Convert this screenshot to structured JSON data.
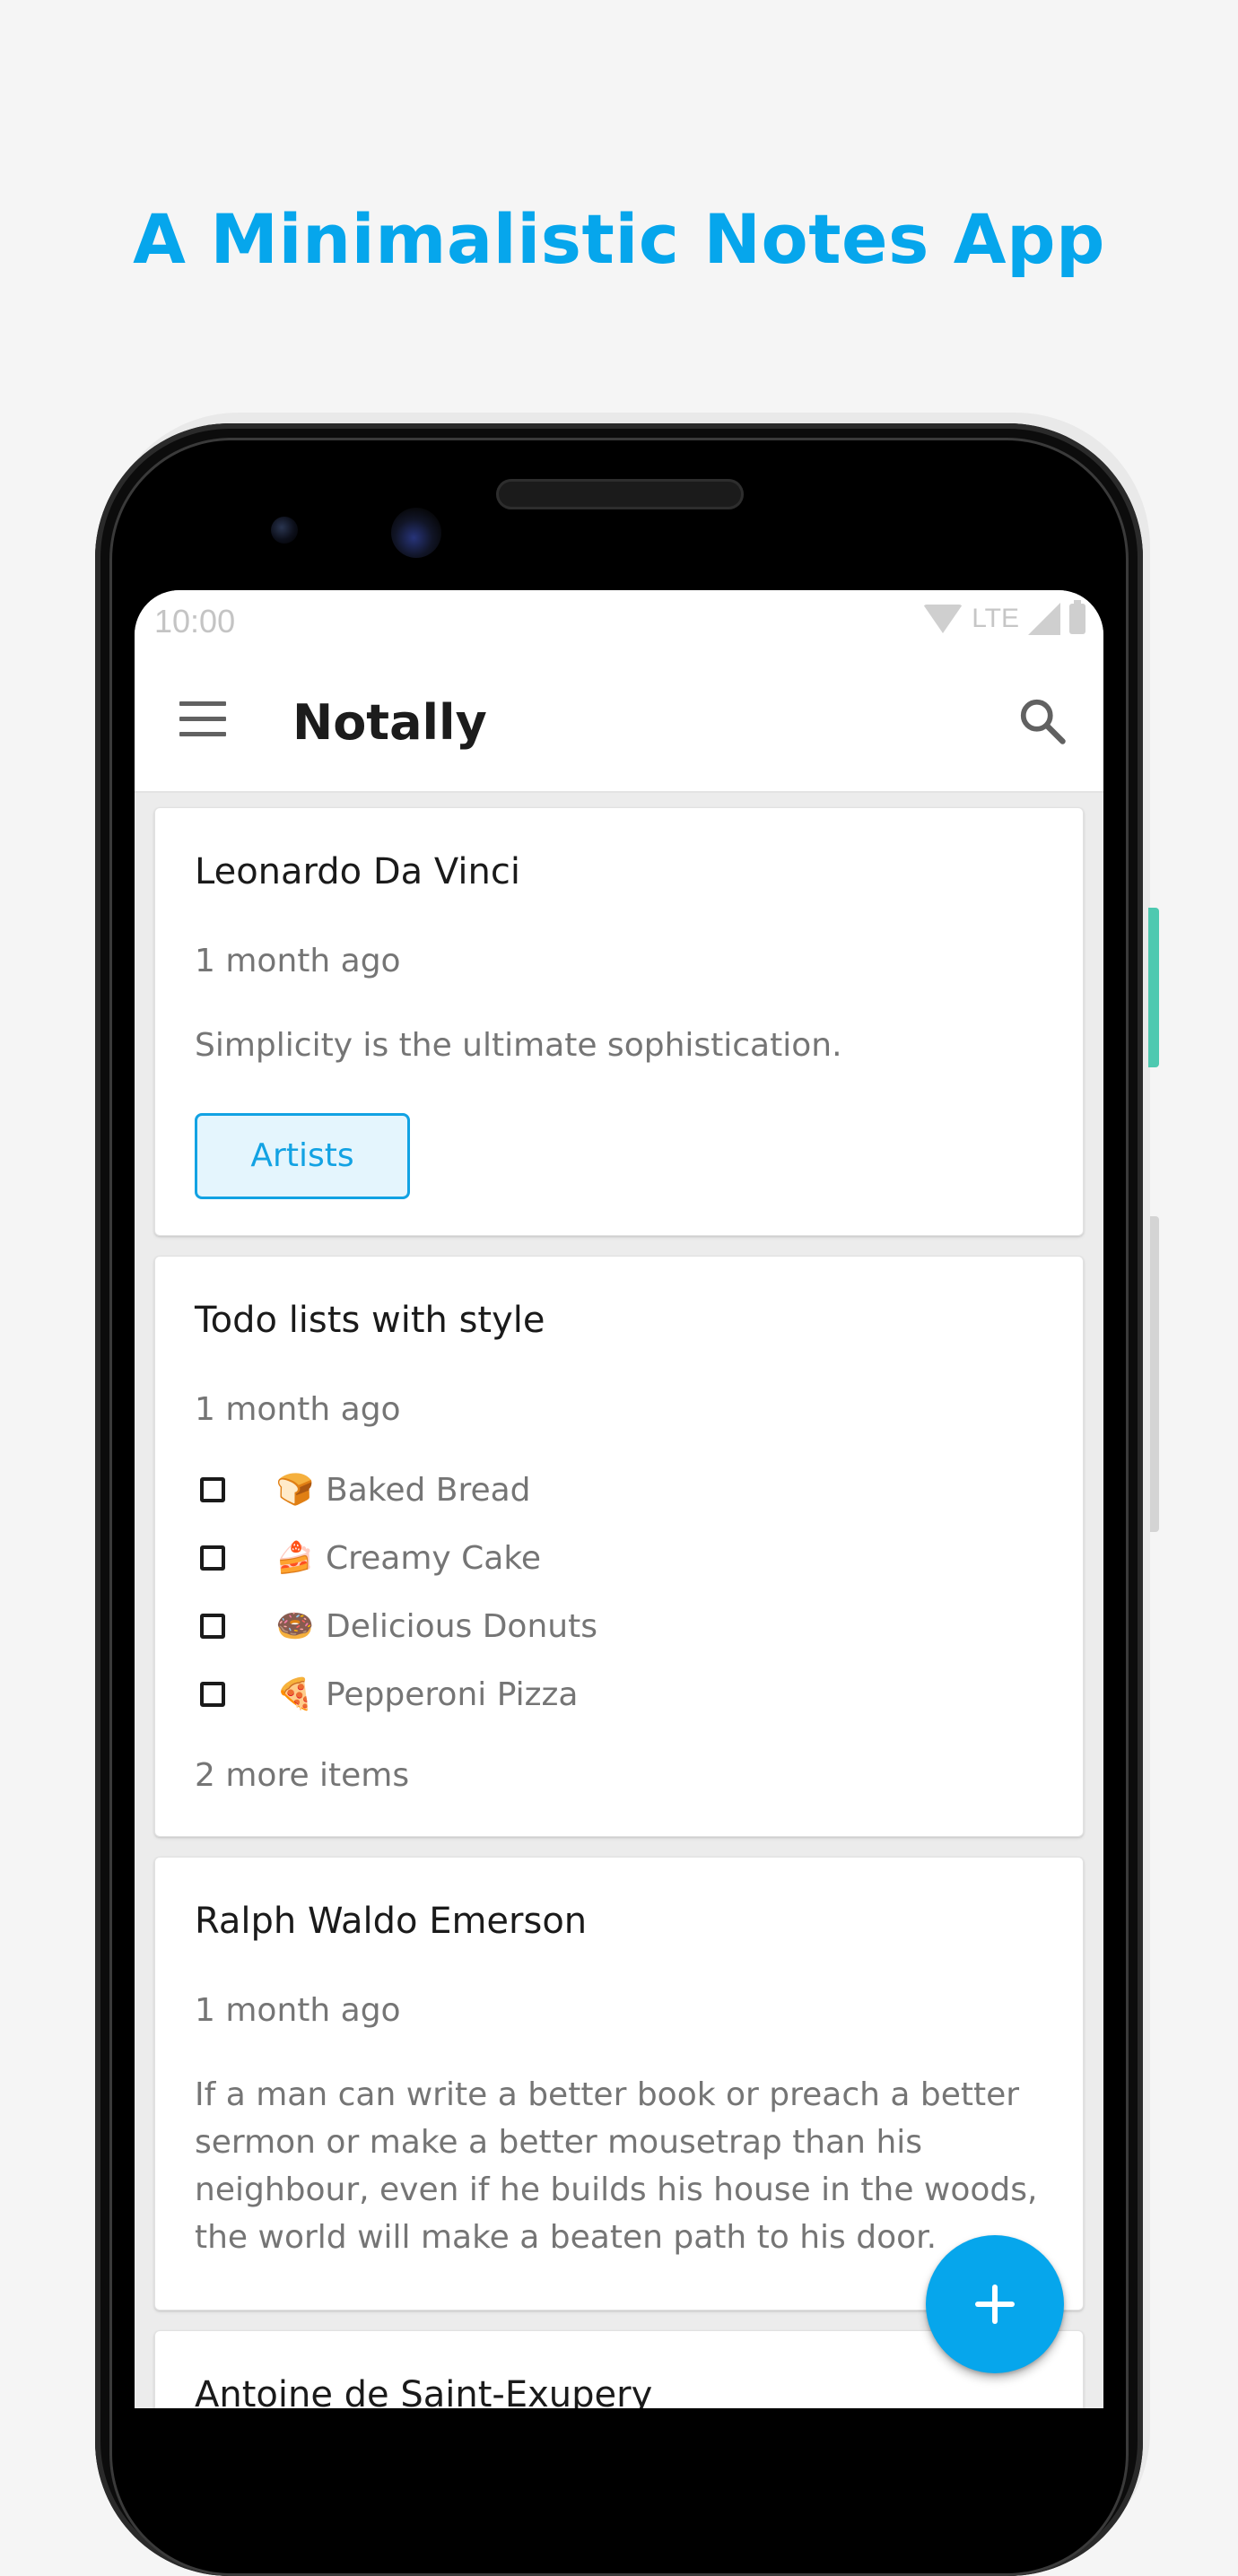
{
  "headline": "A Minimalistic Notes App",
  "status_bar": {
    "time": "10:00",
    "network": "LTE"
  },
  "app_bar": {
    "title": "Notally",
    "menu_icon": "menu-icon",
    "search_icon": "search-icon"
  },
  "notes": [
    {
      "title": "Leonardo Da Vinci",
      "date": "1 month ago",
      "body": "Simplicity is the ultimate sophistication.",
      "label": "Artists"
    },
    {
      "title": "Todo lists with style",
      "date": "1 month ago",
      "items": [
        {
          "emoji": "🍞",
          "text": "Baked Bread",
          "checked": false
        },
        {
          "emoji": "🍰",
          "text": "Creamy Cake",
          "checked": false
        },
        {
          "emoji": "🍩",
          "text": "Delicious Donuts",
          "checked": false
        },
        {
          "emoji": "🍕",
          "text": "Pepperoni Pizza",
          "checked": false
        }
      ],
      "more": "2 more items"
    },
    {
      "title": "Ralph Waldo Emerson",
      "date": "1 month ago",
      "body": "If a man can write a better book or preach a better sermon or make a better mousetrap than his neighbour, even if he builds his house in the woods, the world will make a beaten path to his door."
    },
    {
      "title": "Antoine de Saint-Exupery"
    }
  ],
  "fab": {
    "icon": "plus-icon"
  },
  "colors": {
    "accent": "#06a6ec",
    "background": "#f5f5f5",
    "card": "#ffffff",
    "label_fill": "#e4f5fd",
    "label_border": "#12a2e3"
  }
}
